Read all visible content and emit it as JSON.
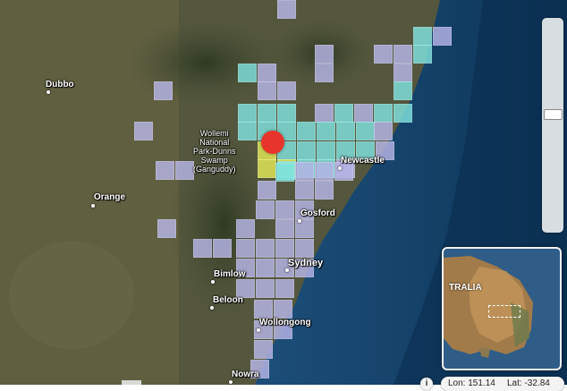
{
  "map": {
    "colors": {
      "land": "#4a4f38",
      "ocean": "#0f3f6a",
      "cell_lavender": "#b7b6e8",
      "cell_cyan": "#7fe3df",
      "cell_yellow": "#e4ea57",
      "marker": "#e8352b"
    },
    "places": {
      "dubbo": "Dubbo",
      "wollemi": "Wollemi\nNational\nPark-Dunns\nSwamp\n(Ganguddy)",
      "orange": "Orange",
      "newcastle": "Newcastle",
      "gosford": "Gosford",
      "sydney": "Sydney",
      "bimlow": "Bimlow",
      "beloon": "Beloon",
      "wollongong": "Wollongong",
      "nowra": "Nowra"
    }
  },
  "zoom": {
    "level_fraction": 0.57
  },
  "minimap": {
    "label": "TRALIA"
  },
  "coords": {
    "lon": "Lon: 151.14",
    "lat": "Lat: -32.84"
  },
  "info": {
    "glyph": "i"
  }
}
